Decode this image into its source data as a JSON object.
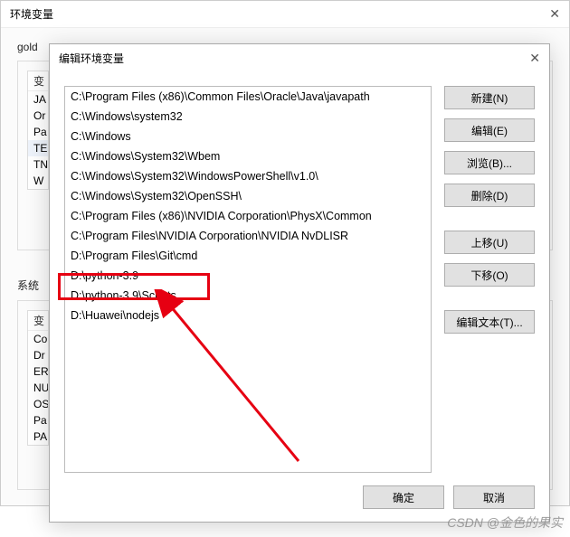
{
  "back_dialog": {
    "title": "环境变量",
    "user_group_label": "gold",
    "user_header": "变",
    "user_rows": [
      "JA",
      "Or",
      "Pa",
      "TE",
      "TN",
      "W"
    ],
    "sys_label": "系统",
    "sys_header": "变",
    "sys_rows": [
      "Co",
      "Dr",
      "ER",
      "NU",
      "OS",
      "Pa",
      "PA"
    ]
  },
  "front_dialog": {
    "title": "编辑环境变量",
    "items": [
      "C:\\Program Files (x86)\\Common Files\\Oracle\\Java\\javapath",
      "C:\\Windows\\system32",
      "C:\\Windows",
      "C:\\Windows\\System32\\Wbem",
      "C:\\Windows\\System32\\WindowsPowerShell\\v1.0\\",
      "C:\\Windows\\System32\\OpenSSH\\",
      "C:\\Program Files (x86)\\NVIDIA Corporation\\PhysX\\Common",
      "C:\\Program Files\\NVIDIA Corporation\\NVIDIA NvDLISR",
      "D:\\Program Files\\Git\\cmd",
      "D:\\python-3.9",
      "D:\\python-3.9\\Scripts",
      "D:\\Huawei\\nodejs"
    ],
    "buttons": {
      "new": "新建(N)",
      "edit": "编辑(E)",
      "browse": "浏览(B)...",
      "delete": "删除(D)",
      "up": "上移(U)",
      "down": "下移(O)",
      "edit_text": "编辑文本(T)...",
      "ok": "确定",
      "cancel": "取消"
    }
  },
  "watermark": "CSDN @金色的果实"
}
